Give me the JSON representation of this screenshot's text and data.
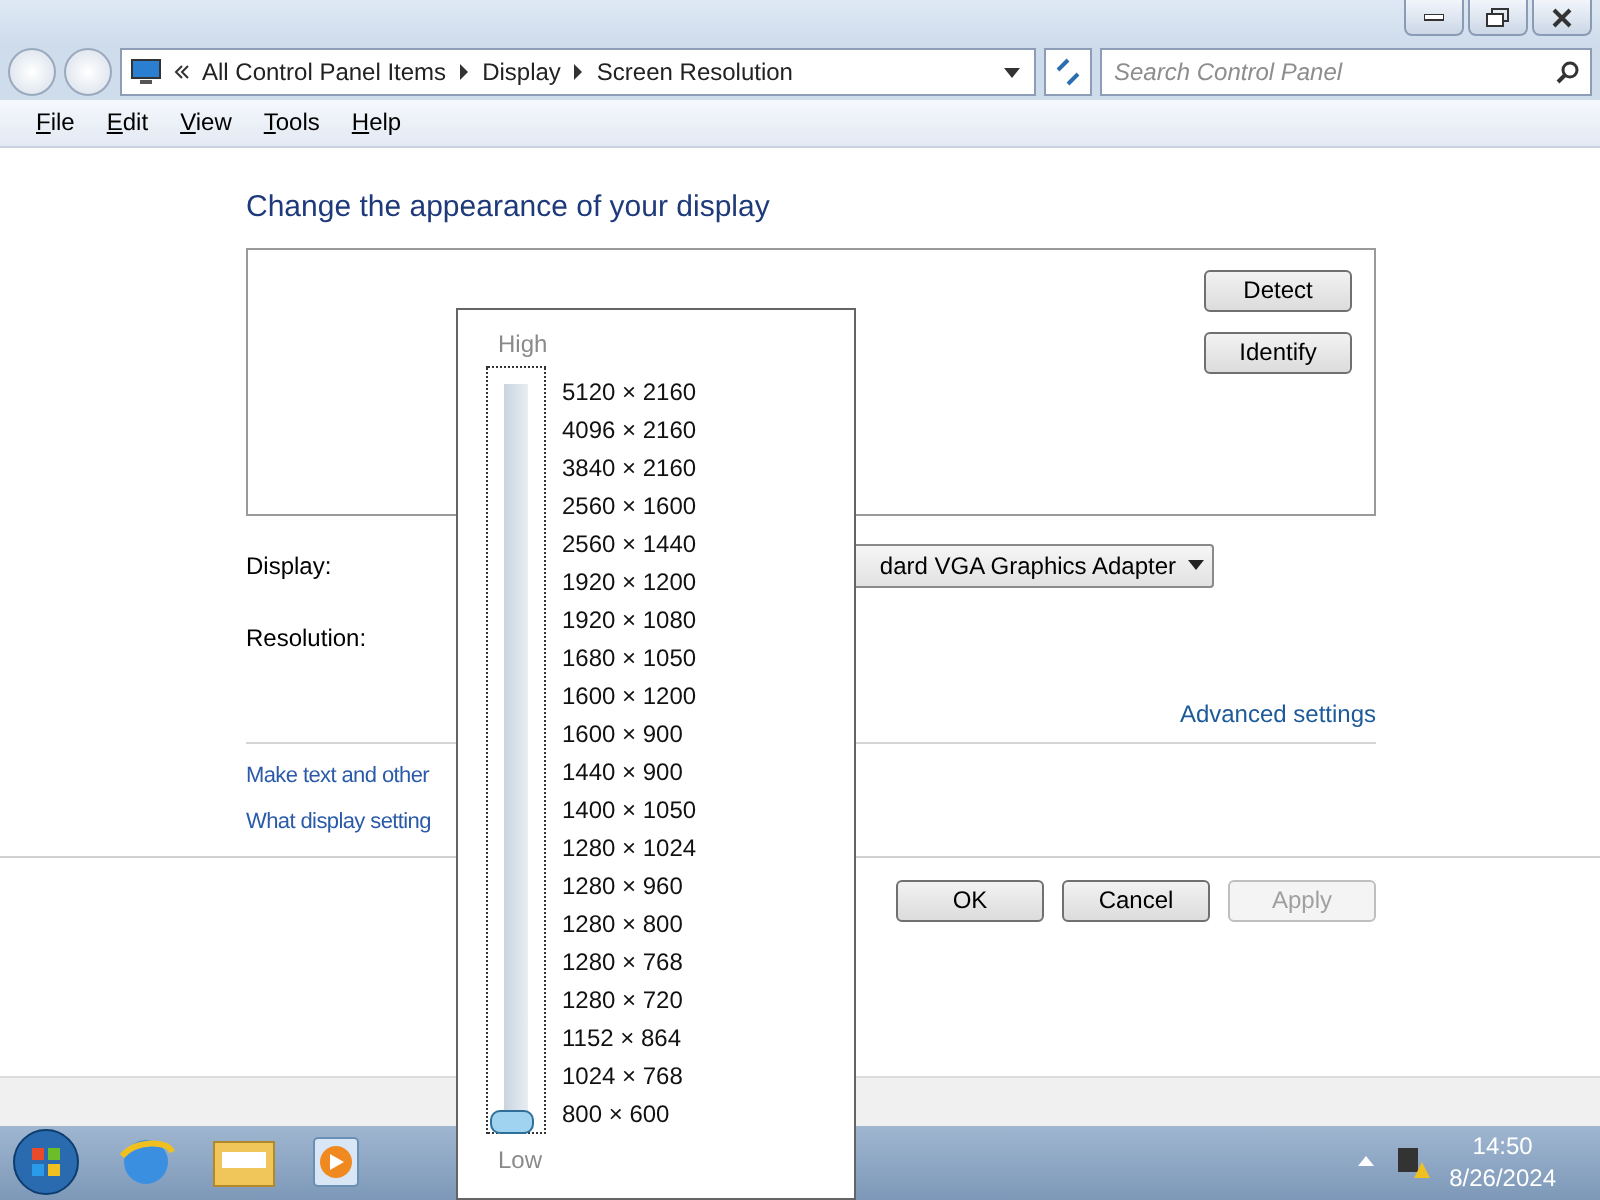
{
  "address_bar": {
    "crumbs": [
      "All Control Panel Items",
      "Display",
      "Screen Resolution"
    ]
  },
  "search": {
    "placeholder": "Search Control Panel"
  },
  "menu": [
    "File",
    "Edit",
    "View",
    "Tools",
    "Help"
  ],
  "content": {
    "heading": "Change the appearance of your display",
    "buttons": [
      {
        "label": "Detect"
      },
      {
        "label": "Identify"
      }
    ],
    "display_label": "Display:",
    "display_value": "dard VGA Graphics Adapter",
    "resolution_label": "Resolution:",
    "advanced_link": "Advanced settings",
    "links": [
      "Make text and other",
      "What display setting"
    ]
  },
  "footer_buttons": [
    {
      "label": "OK",
      "disabled": false
    },
    {
      "label": "Cancel",
      "disabled": false
    },
    {
      "label": "Apply",
      "disabled": true
    }
  ],
  "resolution_popup": {
    "high_label": "High",
    "low_label": "Low",
    "level": 0,
    "options": [
      "5120 × 2160",
      "4096 × 2160",
      "3840 × 2160",
      "2560 × 1600",
      "2560 × 1440",
      "1920 × 1200",
      "1920 × 1080",
      "1680 × 1050",
      "1600 × 1200",
      "1600 × 900",
      "1440 × 900",
      "1400 × 1050",
      "1280 × 1024",
      "1280 × 960",
      "1280 × 800",
      "1280 × 768",
      "1280 × 720",
      "1152 × 864",
      "1024 × 768",
      "800 × 600"
    ]
  },
  "taskbar": {
    "time": "14:50",
    "date": "8/26/2024"
  }
}
